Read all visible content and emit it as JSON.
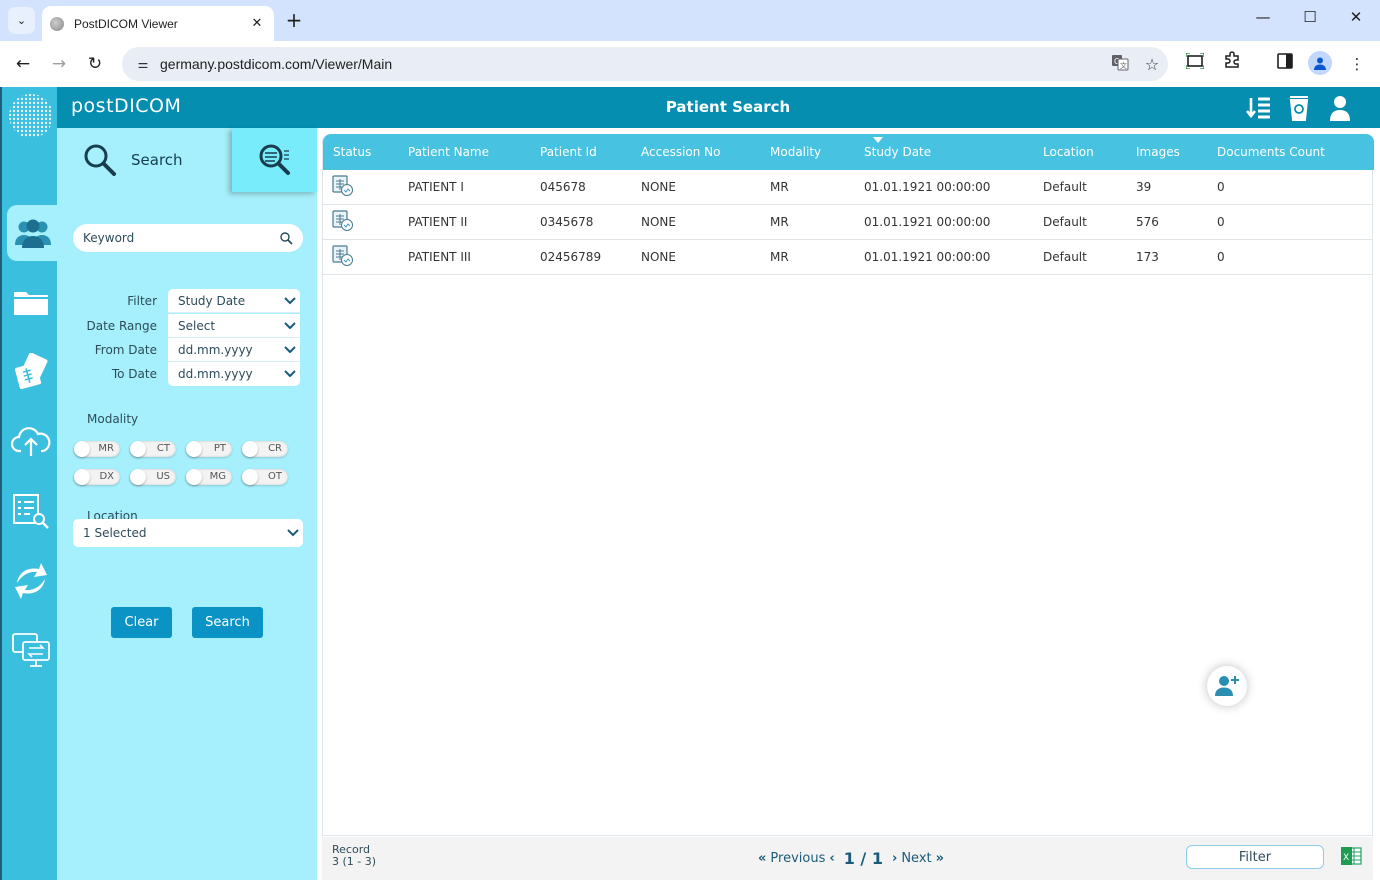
{
  "browser": {
    "tab_title": "PostDICOM Viewer",
    "url": "germany.postdicom.com/Viewer/Main",
    "window_controls": {
      "minimize": "—",
      "maximize": "☐",
      "close": "✕"
    }
  },
  "header": {
    "brand": "postDICOM",
    "title": "Patient Search",
    "icons": [
      "sort-icon",
      "recycle-bin-icon",
      "user-icon"
    ]
  },
  "rail": {
    "items": [
      "patients-icon",
      "folder-icon",
      "dicom-cards-icon",
      "cloud-upload-icon",
      "list-search-icon",
      "sync-icon",
      "transfer-monitor-icon"
    ],
    "active": "patients-icon"
  },
  "panel": {
    "search_tab_label": "Search",
    "keyword_placeholder": "Keyword",
    "filters": [
      {
        "label": "Filter",
        "value": "Study Date"
      },
      {
        "label": "Date Range",
        "value": "Select"
      },
      {
        "label": "From Date",
        "value": "dd.mm.yyyy"
      },
      {
        "label": "To Date",
        "value": "dd.mm.yyyy"
      }
    ],
    "modality_label": "Modality",
    "modalities": [
      {
        "name": "MR",
        "on": false
      },
      {
        "name": "CT",
        "on": false
      },
      {
        "name": "PT",
        "on": false
      },
      {
        "name": "CR",
        "on": false
      },
      {
        "name": "DX",
        "on": false
      },
      {
        "name": "US",
        "on": false
      },
      {
        "name": "MG",
        "on": false
      },
      {
        "name": "OT",
        "on": false
      }
    ],
    "location_label": "Location",
    "location_value": "1 Selected",
    "clear_label": "Clear",
    "search_label": "Search"
  },
  "table": {
    "columns": [
      "Status",
      "Patient Name",
      "Patient Id",
      "Accession No",
      "Modality",
      "Study Date",
      "Location",
      "Images",
      "Documents Count"
    ],
    "sorted_column": "Study Date",
    "rows": [
      {
        "patient_name": "PATIENT I",
        "patient_id": "045678",
        "accession_no": "NONE",
        "modality": "MR",
        "study_date": "01.01.1921 00:00:00",
        "location": "Default",
        "images": "39",
        "documents_count": "0"
      },
      {
        "patient_name": "PATIENT II",
        "patient_id": "0345678",
        "accession_no": "NONE",
        "modality": "MR",
        "study_date": "01.01.1921 00:00:00",
        "location": "Default",
        "images": "576",
        "documents_count": "0"
      },
      {
        "patient_name": "PATIENT III",
        "patient_id": "02456789",
        "accession_no": "NONE",
        "modality": "MR",
        "study_date": "01.01.1921 00:00:00",
        "location": "Default",
        "images": "173",
        "documents_count": "0"
      }
    ]
  },
  "footer": {
    "record_label": "Record",
    "record_value": "3 (1 - 3)",
    "previous_label": "Previous",
    "page": "1 / 1",
    "next_label": "Next",
    "filter_label": "Filter"
  },
  "colors": {
    "header": "#058eb0",
    "rail": "#3bbfdf",
    "panel": "#a5f0fc",
    "table_header": "#47c3e1",
    "button": "#0b93c5"
  }
}
